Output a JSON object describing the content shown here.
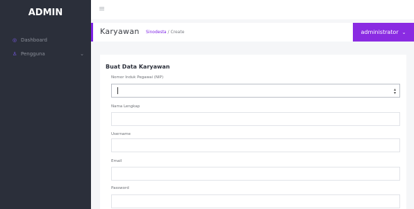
{
  "sidebar": {
    "brand": "ADMIN",
    "items": [
      {
        "label": "Dashboard",
        "icon": "dashboard-icon",
        "glyph": "◎"
      },
      {
        "label": "Pengguna",
        "icon": "user-icon",
        "glyph": "♙",
        "chevron": "⌄"
      }
    ]
  },
  "topbar": {
    "hamburger": "≡"
  },
  "pagebar": {
    "title": "Karyawan",
    "crumb_link": "Sinodesta",
    "crumb_sep": " / ",
    "crumb_current": "Create",
    "user": "administrator",
    "user_chevron": "⌄"
  },
  "form": {
    "title": "Buat Data Karyawan",
    "fields": [
      {
        "label": "Nomor Induk Pegawai (NIP)",
        "value": ""
      },
      {
        "label": "Nama Lengkap",
        "value": ""
      },
      {
        "label": "Username",
        "value": ""
      },
      {
        "label": "Email",
        "value": ""
      },
      {
        "label": "Password",
        "value": ""
      }
    ],
    "spin_up": "▴",
    "spin_down": "▾"
  },
  "colors": {
    "sidebar": "#2b2f3a",
    "accent": "#8a2be2",
    "background": "#f5f6f8"
  }
}
